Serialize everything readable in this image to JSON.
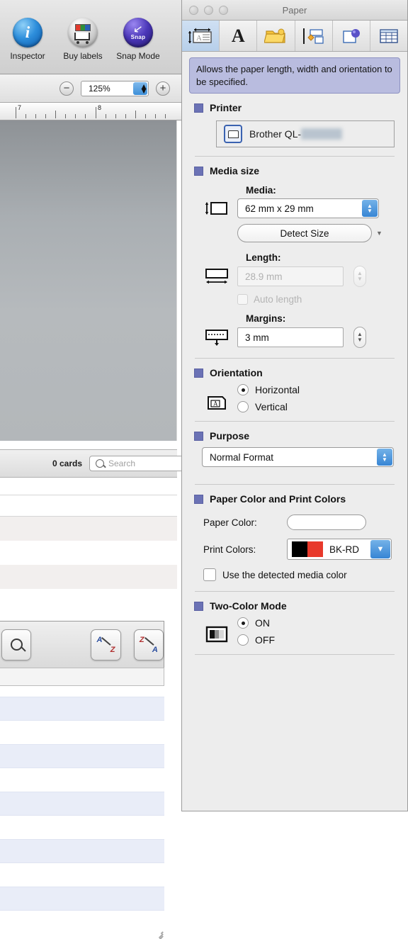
{
  "left_app": {
    "toolbar": [
      {
        "label": "Inspector",
        "icon": "info-icon"
      },
      {
        "label": "Buy labels",
        "icon": "shopping-cart-icon"
      },
      {
        "label": "Snap Mode",
        "icon": "snap-icon"
      }
    ],
    "snap_badge": "Snap",
    "zoom": {
      "minus": "−",
      "value": "125%",
      "plus": "+"
    },
    "ruler": {
      "marks": [
        "7",
        "8"
      ]
    },
    "cards_count": "0 cards",
    "search_placeholder": "Search",
    "buttons": [
      {
        "name": "search-button",
        "icon": "magnifier-icon"
      },
      {
        "name": "sort-ascending-button",
        "icon": "sort-az-icon"
      },
      {
        "name": "sort-descending-button",
        "icon": "sort-za-icon"
      }
    ]
  },
  "panel": {
    "window_title": "Paper",
    "toolbar": [
      {
        "name": "paper-tab",
        "icon": "paper-icon",
        "active": true
      },
      {
        "name": "text-tab",
        "icon": "text-A-icon",
        "active": false
      },
      {
        "name": "file-tab",
        "icon": "folder-icon",
        "active": false
      },
      {
        "name": "layout-tab",
        "icon": "layout-icon",
        "active": false
      },
      {
        "name": "object-tab",
        "icon": "object-sphere-icon",
        "active": false
      },
      {
        "name": "database-tab",
        "icon": "table-grid-icon",
        "active": false
      }
    ],
    "help_text": "Allows the paper length, width and orientation to be specified.",
    "sections": {
      "printer": {
        "title": "Printer",
        "selected_printer_prefix": "Brother QL-",
        "selected_printer_redacted": "820NWB"
      },
      "media_size": {
        "title": "Media size",
        "media_label": "Media:",
        "media_value": "62 mm x 29 mm",
        "detect_size_label": "Detect Size",
        "length_label": "Length:",
        "length_value": "28.9 mm",
        "auto_length_label": "Auto length",
        "margins_label": "Margins:",
        "margins_value": "3 mm"
      },
      "orientation": {
        "title": "Orientation",
        "options": [
          "Horizontal",
          "Vertical"
        ],
        "selected": "Horizontal",
        "icon_glyph": "A"
      },
      "purpose": {
        "title": "Purpose",
        "value": "Normal Format"
      },
      "paper_color": {
        "title": "Paper Color and Print Colors",
        "paper_color_label": "Paper Color:",
        "paper_color_value": "#ffffff",
        "print_colors_label": "Print Colors:",
        "print_colors_value": "BK-RD",
        "print_colors_swatch": [
          "#000000",
          "#e8392b"
        ],
        "use_detected_label": "Use the detected media color"
      },
      "two_color": {
        "title": "Two-Color Mode",
        "options": [
          "ON",
          "OFF"
        ],
        "selected": "ON"
      }
    }
  },
  "colors": {
    "bullet": "#6b72b5",
    "help_bg": "#b9bcdf",
    "accent_blue": "#3785d4"
  }
}
